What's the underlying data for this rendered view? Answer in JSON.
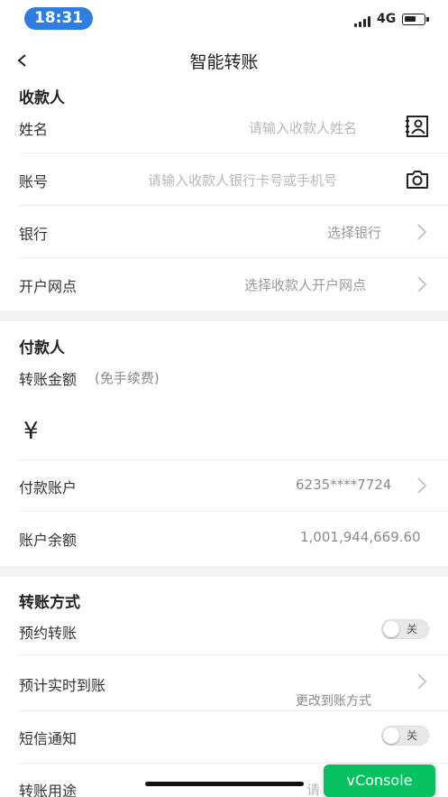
{
  "status": {
    "time": "18:31",
    "network": "4G"
  },
  "nav": {
    "title": "智能转账"
  },
  "payee": {
    "section_title": "收款人",
    "name_label": "姓名",
    "name_placeholder": "请输入收款人姓名",
    "account_label": "账号",
    "account_placeholder": "请输入收款人银行卡号或手机号",
    "bank_label": "银行",
    "bank_value": "选择银行",
    "branch_label": "开户网点",
    "branch_value": "选择收款人开户网点"
  },
  "payer": {
    "section_title": "付款人",
    "amount_label": "转账金额",
    "amount_note": "(免手续费)",
    "currency_symbol": "¥",
    "account_label": "付款账户",
    "account_value": "6235****7724",
    "balance_label": "账户余额",
    "balance_value": "1,001,944,669.60"
  },
  "method": {
    "section_title": "转账方式",
    "scheduled_label": "预约转账",
    "scheduled_toggle": "关",
    "eta_label": "预计实时到账",
    "eta_link": "更改到账方式",
    "sms_label": "短信通知",
    "sms_toggle": "关",
    "purpose_label": "转账用途",
    "purpose_value_partial": "请"
  },
  "vconsole": {
    "label": "vConsole"
  },
  "colors": {
    "status_pill": "#2f7de1",
    "vconsole": "#07c160",
    "section_gap": "#f2f2f2"
  }
}
